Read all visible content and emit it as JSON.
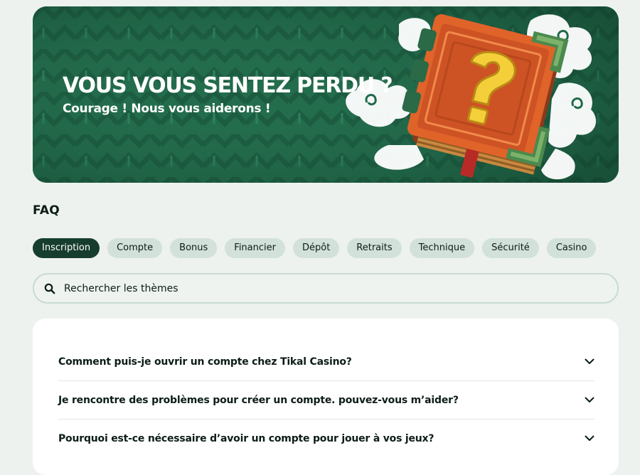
{
  "hero": {
    "title": "VOUS VOUS SENTEZ PERDU ?",
    "subtitle": "Courage ! Nous vous aiderons !"
  },
  "faq": {
    "heading": "FAQ",
    "tabs": [
      {
        "label": "Inscription",
        "active": true
      },
      {
        "label": "Compte",
        "active": false
      },
      {
        "label": "Bonus",
        "active": false
      },
      {
        "label": "Financier",
        "active": false
      },
      {
        "label": "Dépôt",
        "active": false
      },
      {
        "label": "Retraits",
        "active": false
      },
      {
        "label": "Technique",
        "active": false
      },
      {
        "label": "Sécurité",
        "active": false
      },
      {
        "label": "Casino",
        "active": false
      }
    ],
    "search": {
      "placeholder": "Rechercher les thèmes",
      "icon": "search-icon"
    },
    "questions": [
      {
        "text": "Comment puis-je ouvrir un compte chez Tikal Casino?",
        "icon": "chevron-down-icon"
      },
      {
        "text": "Je rencontre des problèmes pour créer un compte. pouvez-vous m’aider?",
        "icon": "chevron-down-icon"
      },
      {
        "text": "Pourquoi est-ce nécessaire d’avoir un compte pour jouer à vos jeux?",
        "icon": "chevron-down-icon"
      }
    ]
  },
  "colors": {
    "page_background": "#edf2ef",
    "hero_green": "#24704f",
    "active_tab": "#173d2e",
    "inactive_tab": "#d2e1da",
    "text_dark": "#0c1d16",
    "book_orange": "#e0632a",
    "question_mark_yellow": "#f5cf3a"
  }
}
